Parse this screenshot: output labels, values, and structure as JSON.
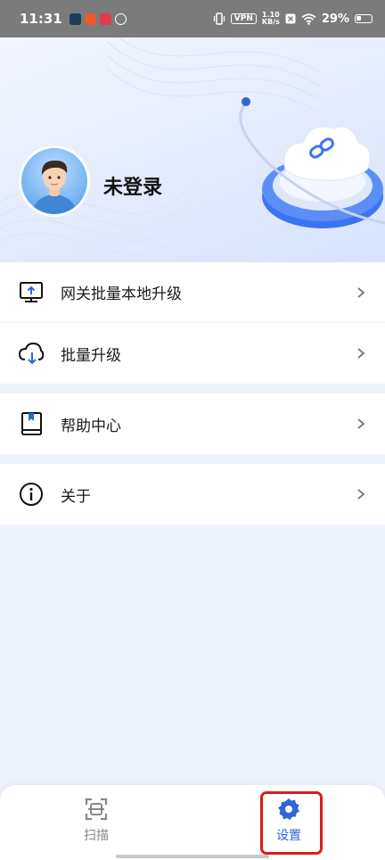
{
  "status_bar": {
    "time": "11:31",
    "vpn": "VPN",
    "speed_value": "1.10",
    "speed_unit": "KB/s",
    "battery": "29%"
  },
  "profile": {
    "login_status": "未登录"
  },
  "menu": {
    "group1": [
      {
        "label": "网关批量本地升级",
        "icon": "monitor-upload-icon"
      },
      {
        "label": "批量升级",
        "icon": "cloud-download-icon"
      }
    ],
    "group2": [
      {
        "label": "帮助中心",
        "icon": "book-icon"
      }
    ],
    "group3": [
      {
        "label": "关于",
        "icon": "info-icon"
      }
    ]
  },
  "bottom_nav": {
    "tabs": [
      {
        "label": "扫描",
        "icon": "scan-icon",
        "active": false
      },
      {
        "label": "设置",
        "icon": "gear-icon",
        "active": true
      }
    ]
  },
  "colors": {
    "accent": "#2f66d8",
    "highlight": "#d71d1d",
    "background": "#eef2fa"
  }
}
